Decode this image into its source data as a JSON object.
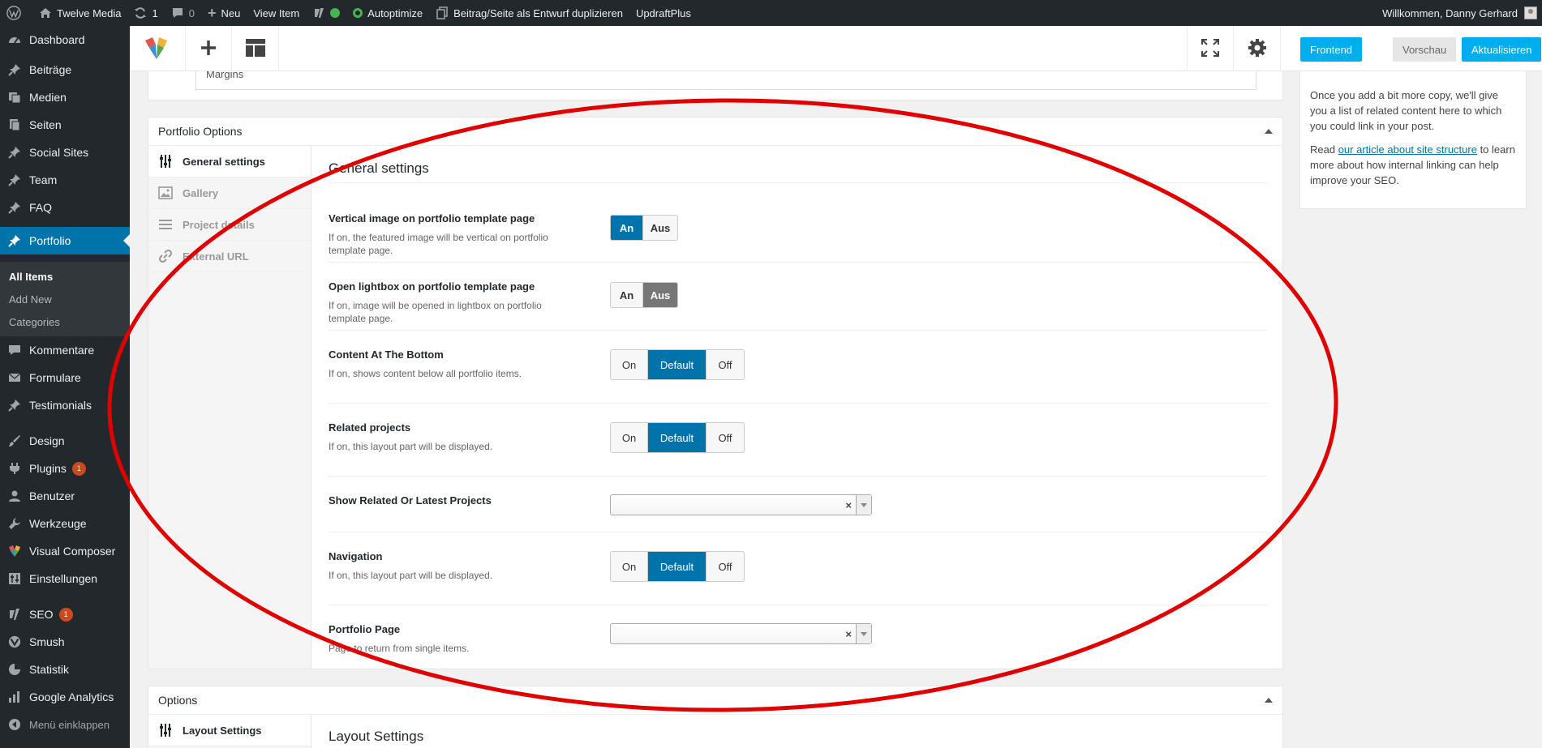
{
  "adminbar": {
    "site_name": "Twelve Media",
    "updates_count": "1",
    "comments_count": "0",
    "new_label": "Neu",
    "view_item": "View Item",
    "autoptimize": "Autoptimize",
    "duplicate": "Beitrag/Seite als Entwurf duplizieren",
    "updraft": "UpdraftPlus",
    "welcome": "Willkommen, Danny Gerhard"
  },
  "sidebar": {
    "items": [
      {
        "label": "Dashboard",
        "icon": "dashboard-icon"
      },
      {
        "label": "Beiträge",
        "icon": "pin-icon"
      },
      {
        "label": "Medien",
        "icon": "media-icon"
      },
      {
        "label": "Seiten",
        "icon": "page-icon"
      },
      {
        "label": "Social Sites",
        "icon": "pin-icon"
      },
      {
        "label": "Team",
        "icon": "pin-icon"
      },
      {
        "label": "FAQ",
        "icon": "pin-icon"
      },
      {
        "label": "Portfolio",
        "icon": "pin-icon"
      },
      {
        "label": "Kommentare",
        "icon": "comment-icon"
      },
      {
        "label": "Formulare",
        "icon": "mail-icon"
      },
      {
        "label": "Testimonials",
        "icon": "pin-icon"
      },
      {
        "label": "Design",
        "icon": "brush-icon"
      },
      {
        "label": "Plugins",
        "icon": "plugin-icon",
        "badge": "1"
      },
      {
        "label": "Benutzer",
        "icon": "user-icon"
      },
      {
        "label": "Werkzeuge",
        "icon": "wrench-icon"
      },
      {
        "label": "Visual Composer",
        "icon": "vc-icon"
      },
      {
        "label": "Einstellungen",
        "icon": "settings-icon"
      },
      {
        "label": "SEO",
        "icon": "yoast-icon",
        "badge": "1"
      },
      {
        "label": "Smush",
        "icon": "smush-icon"
      },
      {
        "label": "Statistik",
        "icon": "pie-icon"
      },
      {
        "label": "Google Analytics",
        "icon": "chart-icon"
      }
    ],
    "submenu": [
      "All Items",
      "Add New",
      "Categories"
    ],
    "collapse": "Menü einklappen"
  },
  "vcbar": {
    "frontend": "Frontend",
    "preview": "Vorschau",
    "update": "Aktualisieren"
  },
  "top_panel_cutoff": "Margins",
  "portfolio": {
    "title": "Portfolio Options",
    "tabs": [
      "General settings",
      "Gallery",
      "Project details",
      "External URL"
    ],
    "section_title": "General settings",
    "options": [
      {
        "label": "Vertical image on portfolio template page",
        "desc1": "If on, the featured image will be vertical on portfolio",
        "desc2": "template page.",
        "buttons": [
          "An",
          "Aus"
        ]
      },
      {
        "label": "Open lightbox on portfolio template page",
        "desc1": "If on, image will be opened in lightbox on portfolio",
        "desc2": "template page.",
        "buttons": [
          "An",
          "Aus"
        ]
      },
      {
        "label": "Content At The Bottom",
        "desc1": "If on, shows content below all portfolio items.",
        "buttons": [
          "On",
          "Default",
          "Off"
        ]
      },
      {
        "label": "Related projects",
        "desc1": "If on, this layout part will be displayed.",
        "buttons": [
          "On",
          "Default",
          "Off"
        ]
      },
      {
        "label": "Show Related Or Latest Projects"
      },
      {
        "label": "Navigation",
        "desc1": "If on, this layout part will be displayed.",
        "buttons": [
          "On",
          "Default",
          "Off"
        ]
      },
      {
        "label": "Portfolio Page",
        "desc1": "Page to return from single items."
      }
    ],
    "select_clear": "×"
  },
  "options_panel": {
    "title": "Options",
    "tab": "Layout Settings",
    "section_title": "Layout Settings"
  },
  "yoast": {
    "p1": "Once you add a bit more copy, we'll give you a list of related content here to which you could link in your post.",
    "p2_pre": "Read ",
    "p2_link": "our article about site structure",
    "p2_post": " to learn more about how internal linking can help improve your SEO."
  },
  "colors": {
    "accent": "#0073aa",
    "vc_blue": "#00aef0",
    "annotation": "#e00000"
  }
}
